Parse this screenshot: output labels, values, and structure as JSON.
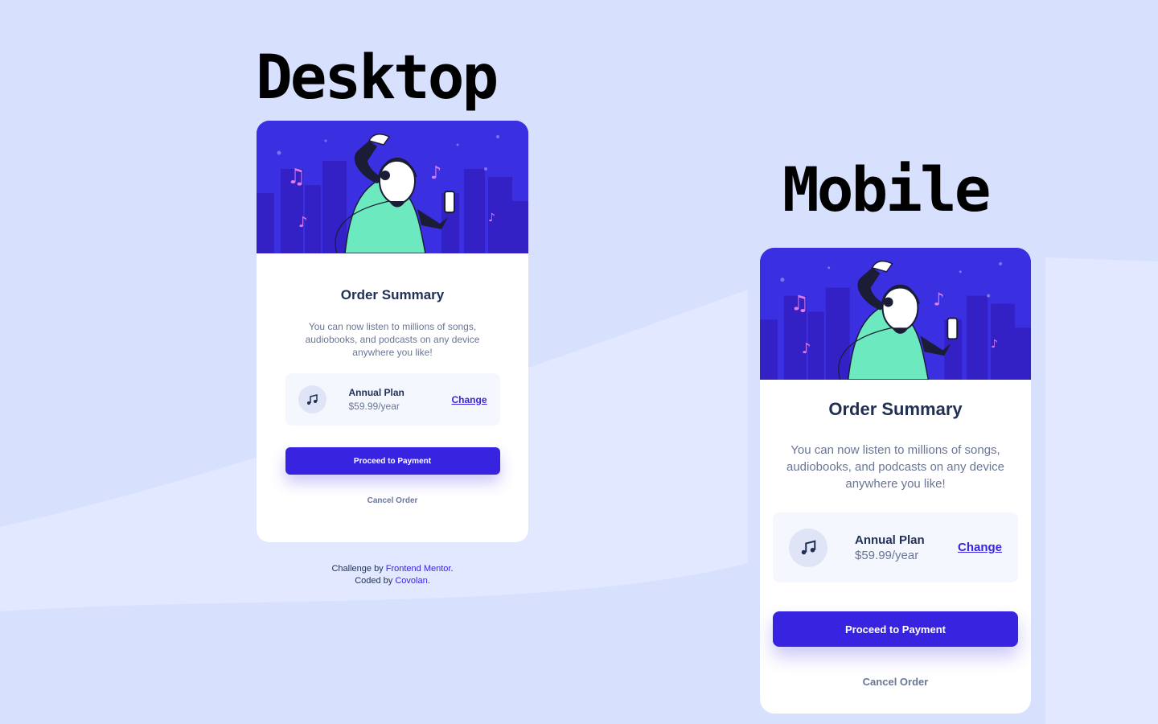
{
  "colors": {
    "background": "#d7e1fe",
    "accent": "#3824e0",
    "hero": "#3b2fe2",
    "title": "#1f2f56",
    "muted": "#6a7696",
    "plan_bg": "#f5f7ff"
  },
  "headings": {
    "desktop": "Desktop",
    "mobile": "Mobile"
  },
  "card": {
    "title": "Order Summary",
    "description": "You can now listen to millions of songs, audiobooks, and podcasts on any device anywhere you like!",
    "plan_icon": "music-note-icon",
    "plan_name": "Annual Plan",
    "plan_price": "$59.99/year",
    "change_label": "Change",
    "pay_label": "Proceed to Payment",
    "cancel_label": "Cancel Order"
  },
  "attribution": {
    "challenge_prefix": "Challenge by",
    "challenge_link": "Frontend Mentor",
    "coded_prefix": "Coded by",
    "coded_link": "Covolan",
    "period": "."
  }
}
